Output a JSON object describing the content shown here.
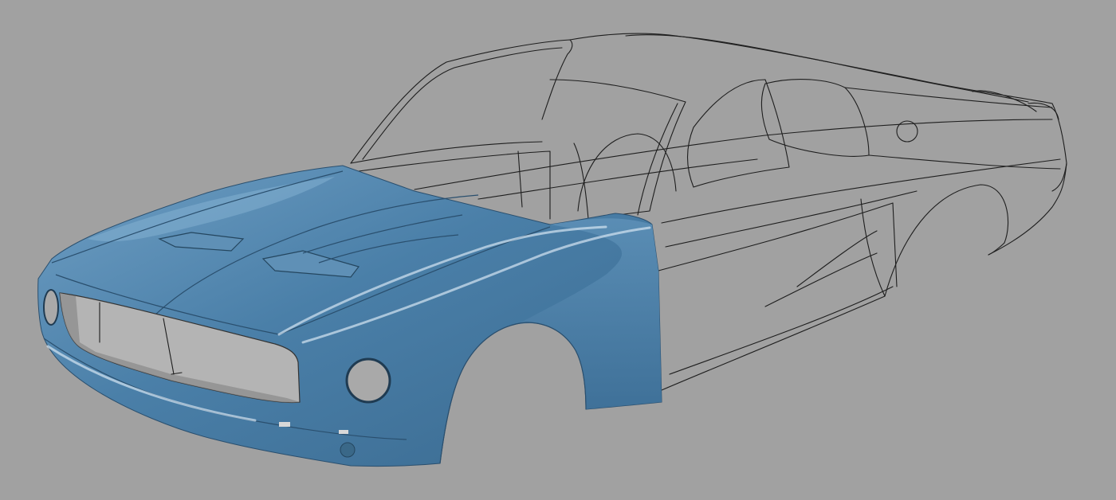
{
  "scene": {
    "subject": "car-body-cad-model",
    "colors": {
      "background": "#a1a1a1",
      "surface": "#4a7fa8",
      "surface_dark": "#33607f",
      "surface_light": "#7fb0d2",
      "wireframe": "#1e1e1e",
      "opening": "#b4b4b4"
    }
  }
}
